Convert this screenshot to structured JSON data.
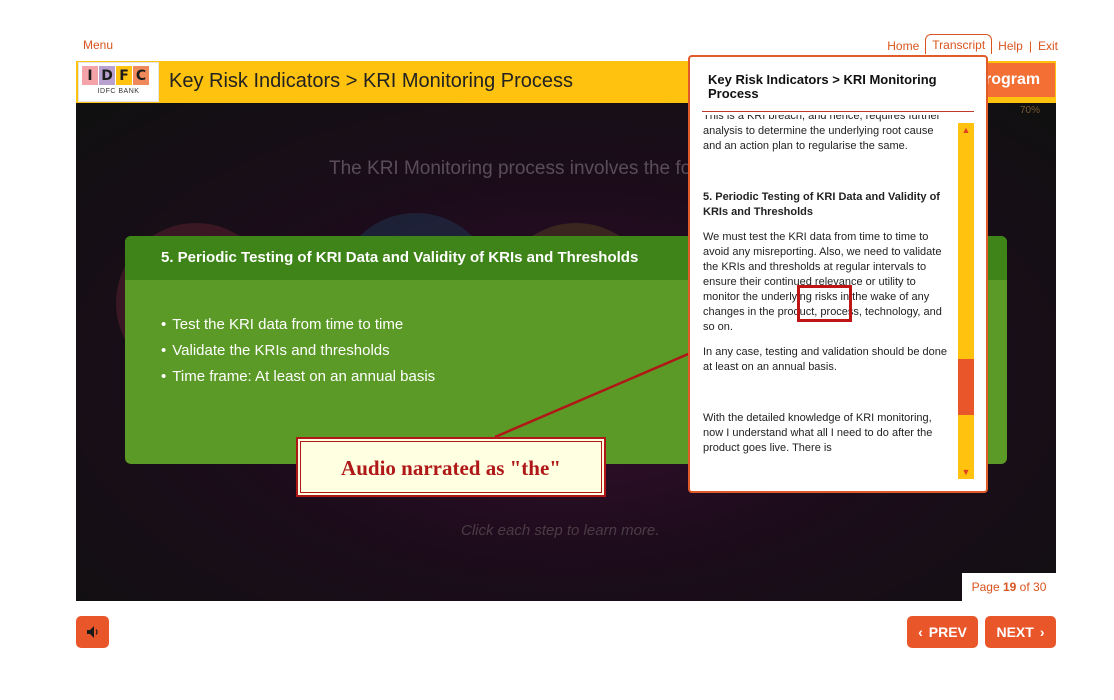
{
  "top_nav": {
    "menu_label": "Menu",
    "links": [
      "Home",
      "Transcript",
      "Help",
      "Exit"
    ],
    "separator": "|"
  },
  "header": {
    "logo_letters": [
      "I",
      "D",
      "F",
      "C"
    ],
    "logo_sub": "IDFC BANK",
    "title": "Key Risk Indicators > KRI Monitoring Process",
    "progress_label": "rogram",
    "progress_percent": "70%"
  },
  "stage": {
    "intro_text": "The KRI Monitoring process involves the fo",
    "click_hint": "Click each step to learn more."
  },
  "popup": {
    "title": "5. Periodic Testing of KRI Data and Validity of KRIs and Thresholds",
    "bullets": [
      "Test the KRI data from time to time",
      "Validate the KRIs and thresholds",
      "Time frame: At least on an annual basis"
    ]
  },
  "callout": {
    "text": "Audio narrated as \"the\""
  },
  "transcript": {
    "title": "Key Risk Indicators > KRI Monitoring Process",
    "paragraphs": [
      "This is a KRI breach, and hence, requires further analysis to determine the underlying root cause and an action plan to regularise the same.",
      "5. Periodic Testing of KRI Data and Validity of KRIs and Thresholds",
      "We must test the KRI data from time to time to avoid any misreporting. Also, we need to validate the KRIs and thresholds at regular intervals to ensure their continued relevance or utility to monitor the underlying risks in the wake of any changes in the product, process, technology, and so on.",
      "In any case, testing and validation should be done at least on an annual basis.",
      "With the detailed knowledge of KRI monitoring, now I understand what all I need to do after the product goes live. There is"
    ]
  },
  "footer": {
    "page_prefix": "Page",
    "page_current": "19",
    "page_of": "of",
    "page_total": "30",
    "prev_label": "PREV",
    "next_label": "NEXT"
  },
  "colors": {
    "accent": "#e8562a",
    "header_yellow": "#ffc20e",
    "popup_green": "#5b9a26",
    "callout_red": "#b01818"
  }
}
